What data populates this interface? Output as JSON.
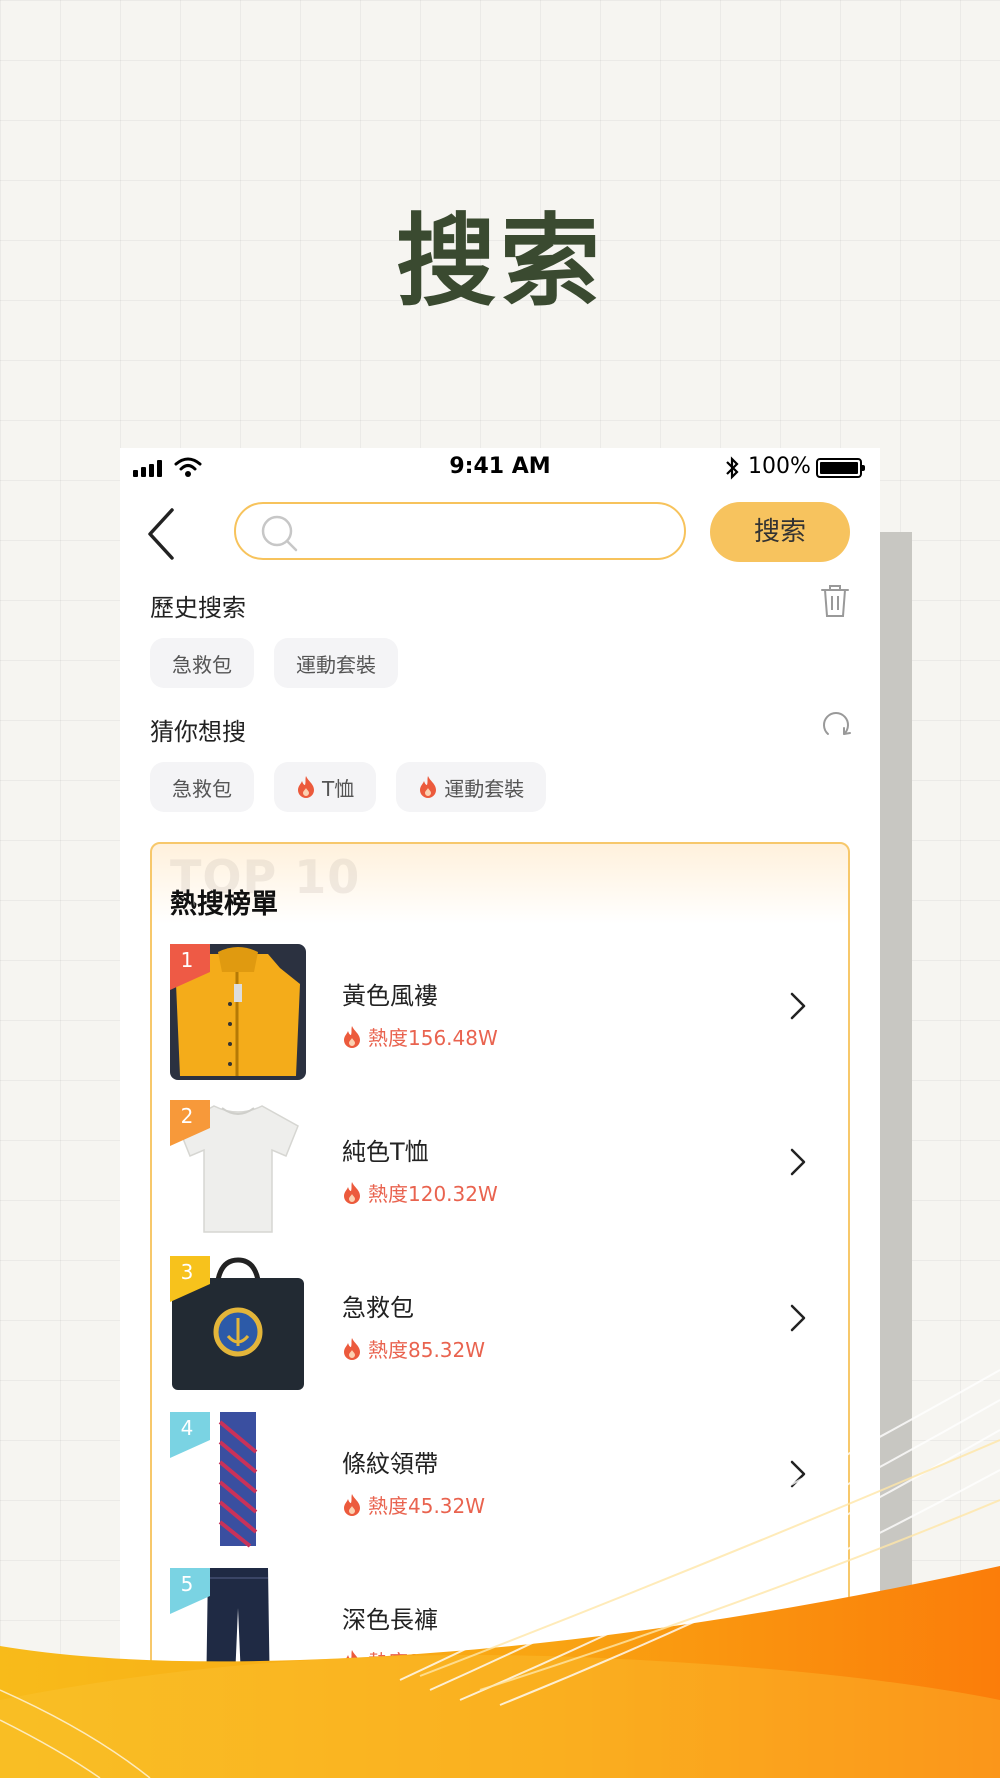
{
  "headline": "搜索",
  "status_bar": {
    "time": "9:41 AM",
    "battery": "100%"
  },
  "header": {
    "search_placeholder": "",
    "search_button": "搜索"
  },
  "history": {
    "title": "歷史搜索",
    "items": [
      "急救包",
      "運動套裝"
    ]
  },
  "suggest": {
    "title": "猜你想搜",
    "items": [
      {
        "label": "急救包",
        "hot": false
      },
      {
        "label": "T恤",
        "hot": true
      },
      {
        "label": "運動套裝",
        "hot": true
      }
    ]
  },
  "hot_list": {
    "bg_text": "TOP 10",
    "title": "熱搜榜單",
    "items": [
      {
        "rank": "1",
        "name": "黃色風褸",
        "heat": "熱度156.48W",
        "badge_color": "#ee5a45"
      },
      {
        "rank": "2",
        "name": "純色T恤",
        "heat": "熱度120.32W",
        "badge_color": "#f7993a"
      },
      {
        "rank": "3",
        "name": "急救包",
        "heat": "熱度85.32W",
        "badge_color": "#f7c21c"
      },
      {
        "rank": "4",
        "name": "條紋領帶",
        "heat": "熱度45.32W",
        "badge_color": "#7ad3e3"
      },
      {
        "rank": "5",
        "name": "深色長褲",
        "heat": "熱度18.32W",
        "badge_color": "#7ad3e3"
      }
    ]
  },
  "colors": {
    "accent": "#f7c35e",
    "heat": "#e9634f",
    "headline": "#3a4a30"
  },
  "icons": [
    "back-arrow-icon",
    "search-icon",
    "trash-icon",
    "refresh-icon",
    "fire-icon",
    "chevron-right-icon"
  ]
}
